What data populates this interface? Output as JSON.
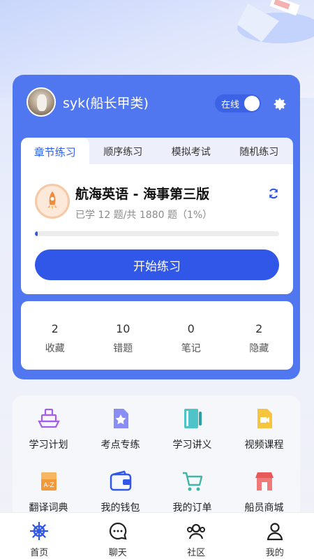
{
  "user": {
    "name": "syk(船长甲类)",
    "status_label": "在线"
  },
  "tabs": [
    {
      "label": "章节练习",
      "active": true
    },
    {
      "label": "顺序练习",
      "active": false
    },
    {
      "label": "模拟考试",
      "active": false
    },
    {
      "label": "随机练习",
      "active": false
    }
  ],
  "practice": {
    "book_title": "航海英语 - 海事第三版",
    "progress_text": "已学 12 题/共 1880 题（1%）",
    "progress_fraction": 0.01,
    "start_button": "开始练习"
  },
  "stats": [
    {
      "value": "2",
      "label": "收藏"
    },
    {
      "value": "10",
      "label": "错题"
    },
    {
      "value": "0",
      "label": "笔记"
    },
    {
      "value": "2",
      "label": "隐藏"
    }
  ],
  "grid": [
    {
      "label": "学习计划",
      "icon": "ship-icon"
    },
    {
      "label": "考点专练",
      "icon": "star-document-icon"
    },
    {
      "label": "学习讲义",
      "icon": "notebook-icon"
    },
    {
      "label": "视频课程",
      "icon": "video-document-icon"
    },
    {
      "label": "翻译词典",
      "icon": "dictionary-icon"
    },
    {
      "label": "我的钱包",
      "icon": "wallet-icon"
    },
    {
      "label": "我的订单",
      "icon": "cart-icon"
    },
    {
      "label": "船员商城",
      "icon": "store-icon"
    }
  ],
  "nav": [
    {
      "label": "首页",
      "icon": "helm-icon",
      "active": true
    },
    {
      "label": "聊天",
      "icon": "chat-icon",
      "active": false
    },
    {
      "label": "社区",
      "icon": "community-icon",
      "active": false
    },
    {
      "label": "我的",
      "icon": "profile-icon",
      "active": false
    }
  ],
  "colors": {
    "primary": "#3157e8",
    "card": "#5177f0",
    "accent_orange": "#f08a3c"
  }
}
